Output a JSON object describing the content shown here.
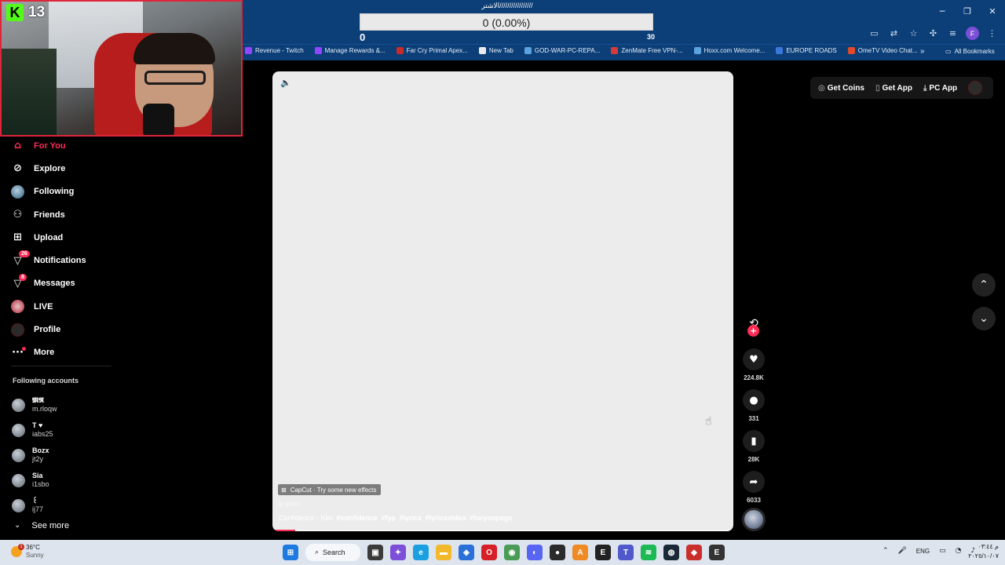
{
  "browser": {
    "bookmarks": [
      {
        "label": "Revenue - Twitch",
        "color": "#9146ff"
      },
      {
        "label": "Manage Rewards &...",
        "color": "#9146ff"
      },
      {
        "label": "Far Cry Primal Apex...",
        "color": "#c92a2a"
      },
      {
        "label": "New Tab",
        "color": "#e8eaed"
      },
      {
        "label": "GOD-WAR-PC-REPA...",
        "color": "#5aa2e0"
      },
      {
        "label": "ZenMate Free VPN-...",
        "color": "#d83a3a"
      },
      {
        "label": "Hoxx.com Welcome...",
        "color": "#5aa2e0"
      },
      {
        "label": "EUROPE ROADS",
        "color": "#3a77d8"
      },
      {
        "label": "OmeTV Video Chat...",
        "color": "#e04a2a"
      }
    ],
    "all_bookmarks": "All Bookmarks",
    "profile_initial": "F"
  },
  "goal": {
    "title": "الاشتر/////////////////",
    "progress_text": "0 (0.00%)",
    "progress_fraction": 0,
    "min": "0",
    "max": "30"
  },
  "webcam": {
    "kick_logo": "K",
    "viewer_count": "13"
  },
  "sidebar": {
    "nav": [
      {
        "label": "For You",
        "icon": "home-icon",
        "active": true
      },
      {
        "label": "Explore",
        "icon": "compass-icon"
      },
      {
        "label": "Following",
        "icon": "avatar"
      },
      {
        "label": "Friends",
        "icon": "friends-icon"
      },
      {
        "label": "Upload",
        "icon": "upload-icon"
      },
      {
        "label": "Notifications",
        "icon": "notification-icon",
        "badge": "26"
      },
      {
        "label": "Messages",
        "icon": "message-icon",
        "badge": "8"
      },
      {
        "label": "LIVE",
        "icon": "live-icon"
      },
      {
        "label": "Profile",
        "icon": "profile-avatar"
      },
      {
        "label": "More",
        "icon": "more-icon",
        "dot": true
      }
    ],
    "following_title": "Following accounts",
    "accounts": [
      {
        "name": "𝕸𝕽",
        "handle": "m.rloqw"
      },
      {
        "name": "T ♥",
        "handle": "iabs25"
      },
      {
        "name": "Bozx",
        "handle": "jt2y"
      },
      {
        "name": "Sia",
        "handle": "i1sbo"
      },
      {
        "name": "꒰",
        "handle": "ij77"
      }
    ],
    "see_more": "See more"
  },
  "video": {
    "capcut_label": "CapCut · Try some new effects",
    "author": "lx.lyrics",
    "caption_text": "Confidence - Kim",
    "hashtags": [
      "#confidence",
      "#fyp",
      "#lyrics",
      "#lyricsvideo",
      "#foryoupage"
    ],
    "progress_fraction": 0.05
  },
  "actions": {
    "likes": "224.8K",
    "comments": "331",
    "saves": "28K",
    "shares": "6033"
  },
  "topright": {
    "get_coins": "Get Coins",
    "get_app": "Get App",
    "pc_app": "PC App"
  },
  "taskbar": {
    "temperature": "36°C",
    "weather": "Sunny",
    "weather_badge": "1",
    "search": "Search",
    "language": "ENG",
    "time": "م ٠٣:٤٤",
    "date": "٢٠٢٥/١٠/٠٧"
  }
}
